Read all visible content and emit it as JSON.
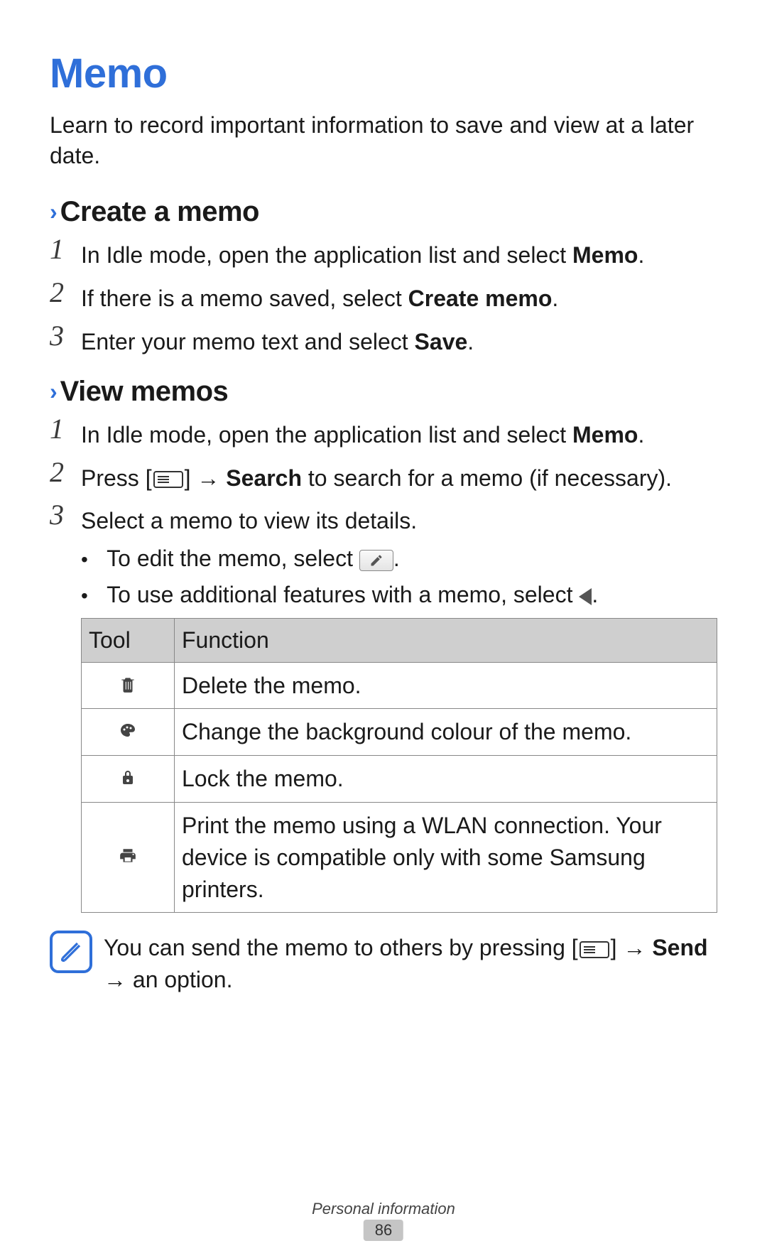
{
  "heading": "Memo",
  "intro": "Learn to record important information to save and view at a later date.",
  "section1": {
    "title": "Create a memo",
    "steps": {
      "s1": {
        "pre": "In Idle mode, open the application list and select ",
        "bold": "Memo",
        "post": "."
      },
      "s2": {
        "pre": "If there is a memo saved, select ",
        "bold": "Create memo",
        "post": "."
      },
      "s3": {
        "pre": "Enter your memo text and select ",
        "bold": "Save",
        "post": "."
      }
    }
  },
  "section2": {
    "title": "View memos",
    "steps": {
      "s1": {
        "pre": "In Idle mode, open the application list and select ",
        "bold": "Memo",
        "post": "."
      },
      "s2": {
        "pre": "Press [",
        "mid": "] → ",
        "bold": "Search",
        "post": " to search for a memo (if necessary)."
      },
      "s3": {
        "text": "Select a memo to view its details.",
        "b1_pre": "To edit the memo, select ",
        "b2_pre": "To use additional features with a memo, select "
      }
    }
  },
  "table": {
    "headers": {
      "tool": "Tool",
      "function": "Function"
    },
    "rows": {
      "r1": "Delete the memo.",
      "r2": "Change the background colour of the memo.",
      "r3": "Lock the memo.",
      "r4": "Print the memo using a WLAN connection. Your device is compatible only with some Samsung printers."
    }
  },
  "note": {
    "pre": "You can send the memo to others by pressing [",
    "mid": "] → ",
    "bold": "Send",
    "post": " → an option."
  },
  "footer": "Personal information",
  "page_number": "86"
}
